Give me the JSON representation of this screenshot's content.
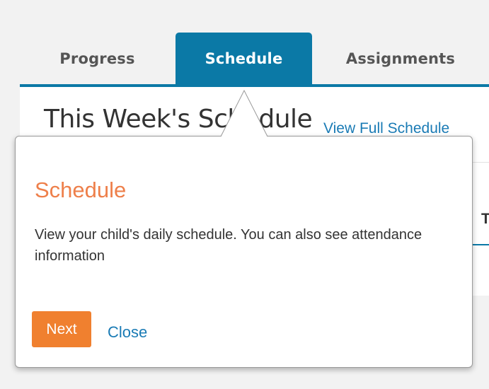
{
  "tabs": [
    {
      "label": "Progress",
      "active": false
    },
    {
      "label": "Schedule",
      "active": true
    },
    {
      "label": "Assignments",
      "active": false
    }
  ],
  "background": {
    "heading": "This Week's Schedule",
    "link": "View Full Schedule",
    "column_label": "T"
  },
  "popover": {
    "title": "Schedule",
    "body": "View your child's daily schedule. You can also see attendance information",
    "next_label": "Next",
    "close_label": "Close"
  },
  "colors": {
    "accent": "#0b79a6",
    "title": "#ee7f4a",
    "button": "#f0802f",
    "link": "#1a7bb5"
  }
}
